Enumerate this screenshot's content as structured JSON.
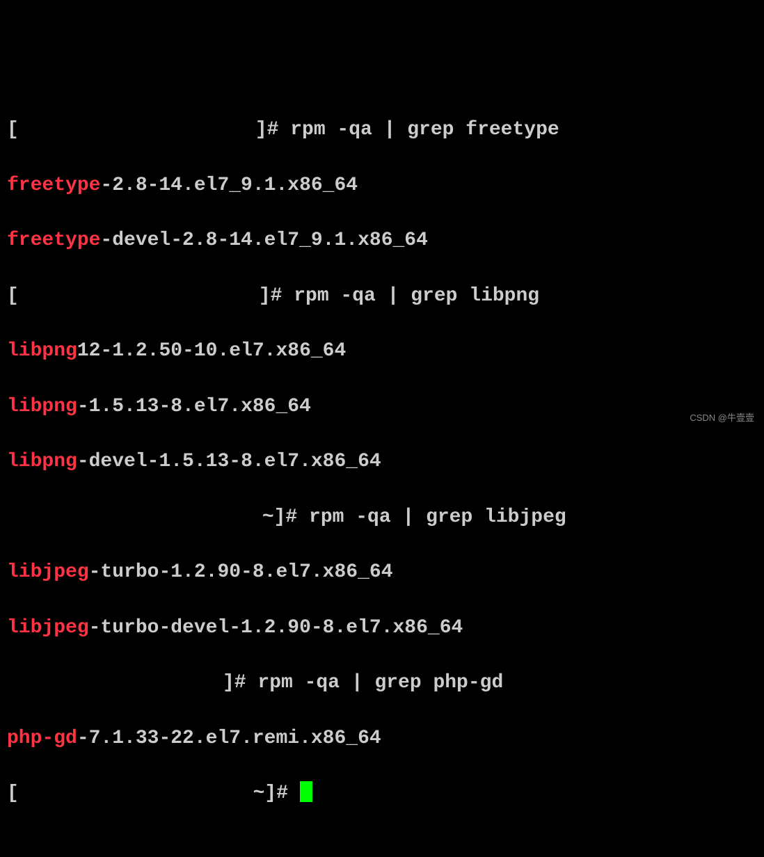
{
  "lines": {
    "l1_bracket_open": "[",
    "l1_bracket_close": "]#",
    "l1_cmd": " rpm -qa | grep freetype",
    "l2_match": "freetype",
    "l2_rest": "-2.8-14.el7_9.1.x86_64",
    "l3_match": "freetype",
    "l3_rest": "-devel-2.8-14.el7_9.1.x86_64",
    "l4_bracket_open": "[",
    "l4_bracket_close": "]#",
    "l4_cmd": " rpm -qa | grep libpng",
    "l5_match": "libpng",
    "l5_rest": "12-1.2.50-10.el7.x86_64",
    "l6_match": "libpng",
    "l6_rest": "-1.5.13-8.el7.x86_64",
    "l7_match": "libpng",
    "l7_rest": "-devel-1.5.13-8.el7.x86_64",
    "l8_prompt_end": "~]#",
    "l8_cmd": " rpm -qa | grep libjpeg",
    "l9_match": "libjpeg",
    "l9_rest": "-turbo-1.2.90-8.el7.x86_64",
    "l10_match": "libjpeg",
    "l10_rest": "-turbo-devel-1.2.90-8.el7.x86_64",
    "l11_bracket_close": "]#",
    "l11_cmd": " rpm -qa | grep php-gd",
    "l12_match": "php-gd",
    "l12_rest": "-7.1.33-22.el7.remi.x86_64",
    "l13_bracket_open": "[",
    "l13_prompt_end": " ~]# "
  },
  "watermark": "CSDN @牛壹壹"
}
